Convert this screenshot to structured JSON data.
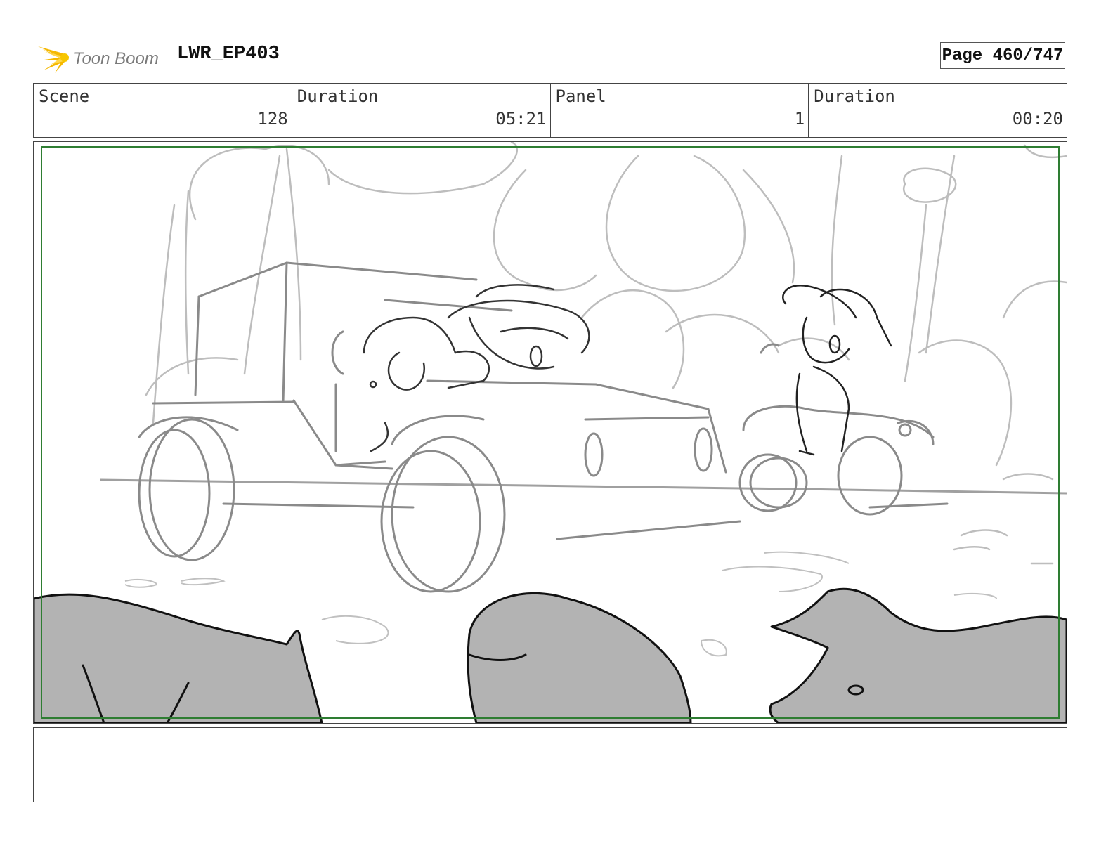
{
  "header": {
    "logo_text": "Toon Boom",
    "project_title": "LWR_EP403",
    "page_label": "Page 460/747"
  },
  "info": {
    "scene_label": "Scene",
    "scene_value": "128",
    "scene_duration_label": "Duration",
    "scene_duration_value": "05:21",
    "panel_label": "Panel",
    "panel_value": "1",
    "panel_duration_label": "Duration",
    "panel_duration_value": "00:20"
  },
  "panel": {
    "frame_color": "#2e7d32",
    "fill_gray": "#b3b3b3"
  },
  "notes": {
    "text": ""
  }
}
